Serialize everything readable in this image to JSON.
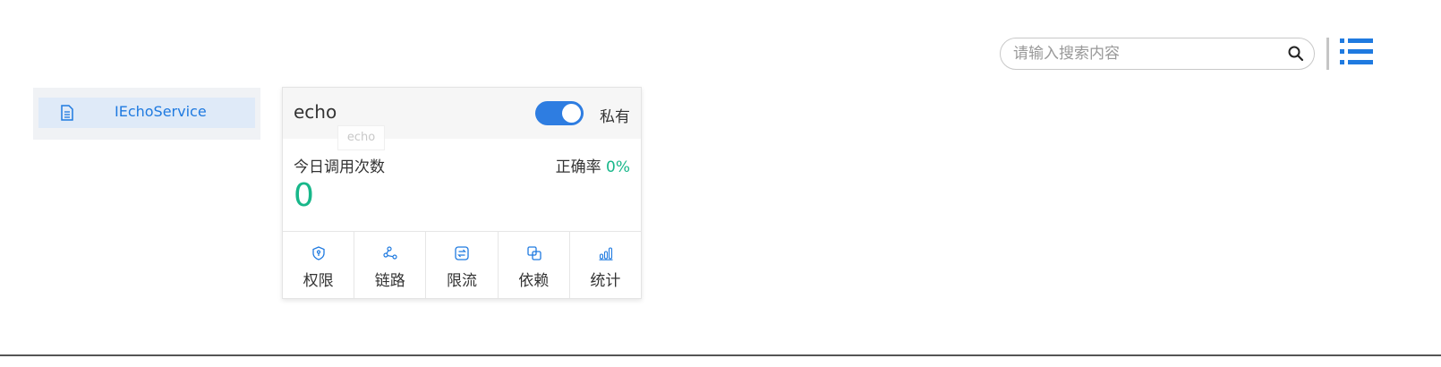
{
  "search": {
    "placeholder": "请输入搜索内容",
    "value": ""
  },
  "icons": {
    "search": "search-icon",
    "menu": "list-icon",
    "doc": "document-icon"
  },
  "sidebar": {
    "items": [
      {
        "label": "IEchoService",
        "selected": true
      }
    ]
  },
  "card": {
    "title": "echo",
    "tooltip": "echo",
    "toggle": {
      "on": true,
      "label": "私有"
    },
    "stats": {
      "label": "今日调用次数",
      "count": "0",
      "accuracy_label": "正确率",
      "accuracy_value": "0%"
    },
    "actions": [
      {
        "label": "权限",
        "icon": "shield-icon"
      },
      {
        "label": "链路",
        "icon": "share-nodes-icon"
      },
      {
        "label": "限流",
        "icon": "swap-icon"
      },
      {
        "label": "依赖",
        "icon": "copy-icon"
      },
      {
        "label": "统计",
        "icon": "bar-chart-icon"
      }
    ]
  },
  "colors": {
    "accent": "#2e7de1",
    "link": "#1f7ae0",
    "success": "#18b78a",
    "selected_bg": "#dfeaf8"
  }
}
